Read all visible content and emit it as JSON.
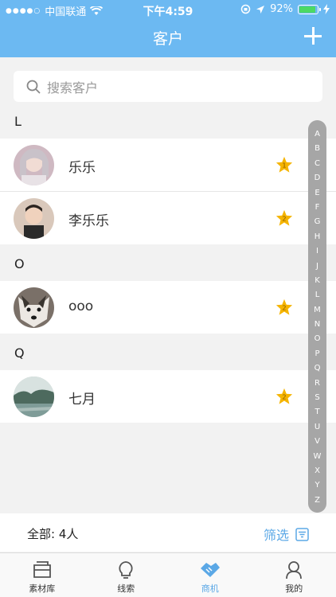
{
  "status": {
    "carrier": "中国联通",
    "time": "下午4:59",
    "battery": "92%",
    "battery_level": 0.92
  },
  "nav": {
    "title": "客户",
    "add_icon": "plus-icon"
  },
  "search": {
    "placeholder": "搜索客户"
  },
  "sections": [
    {
      "letter": "L",
      "items": [
        {
          "name": "乐乐",
          "rank": "1"
        },
        {
          "name": "李乐乐",
          "rank": "2"
        }
      ]
    },
    {
      "letter": "O",
      "items": [
        {
          "name": "ooo",
          "rank": "2"
        }
      ]
    },
    {
      "letter": "Q",
      "items": [
        {
          "name": "七月",
          "rank": "2"
        }
      ]
    }
  ],
  "index_letters": [
    "A",
    "B",
    "C",
    "D",
    "E",
    "F",
    "G",
    "H",
    "I",
    "J",
    "K",
    "L",
    "M",
    "N",
    "O",
    "P",
    "Q",
    "R",
    "S",
    "T",
    "U",
    "V",
    "W",
    "X",
    "Y",
    "Z"
  ],
  "footer": {
    "total": "全部: 4人",
    "filter_label": "筛选"
  },
  "tabs": [
    {
      "label": "素材库",
      "icon": "folder-icon"
    },
    {
      "label": "线索",
      "icon": "lightbulb-icon"
    },
    {
      "label": "商机",
      "icon": "handshake-icon",
      "active": true
    },
    {
      "label": "我的",
      "icon": "person-icon"
    }
  ],
  "colors": {
    "header": "#6cb9f2",
    "accent": "#5ba8e6",
    "star": "#f5b400"
  }
}
